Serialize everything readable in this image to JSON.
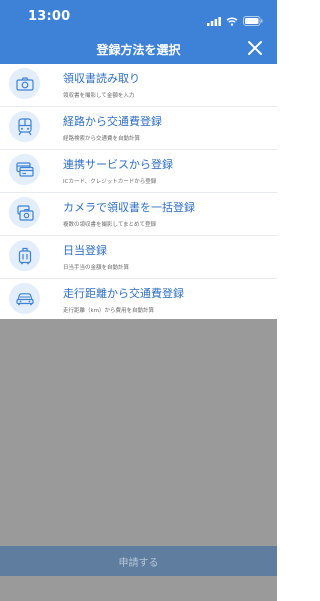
{
  "status_bar": {
    "time": "13:00",
    "icons": [
      "signal-icon",
      "wifi-icon",
      "battery-icon"
    ]
  },
  "header": {
    "title": "登録方法を選択",
    "close_icon": "close-icon"
  },
  "items": [
    {
      "title": "領収書読み取り",
      "desc": "領収書を撮影して金額を入力",
      "icon": "camera-icon"
    },
    {
      "title": "経路から交通費登録",
      "desc": "経路検索から交通費を自動計算",
      "icon": "train-icon"
    },
    {
      "title": "連携サービスから登録",
      "desc": "ICカード、クレジットカードから登録",
      "icon": "cards-icon"
    },
    {
      "title": "カメラで領収書を一括登録",
      "desc": "複数の領収書を撮影してまとめて登録",
      "icon": "multi-receipt-camera-icon"
    },
    {
      "title": "日当登録",
      "desc": "日当手当の金額を自動計算",
      "icon": "suitcase-icon"
    },
    {
      "title": "走行距離から交通費登録",
      "desc": "走行距離（km）から費用を自動計算",
      "icon": "car-icon"
    }
  ],
  "footer": {
    "apply_label": "申請する"
  },
  "colors": {
    "header_bg": "#3d82d6",
    "title_text": "#2f6fc3",
    "icon_bg": "#e3eefa",
    "icon_stroke": "#3d82d6",
    "overlay": "#9a9a9a",
    "apply_bar": "#5e7d9f"
  }
}
